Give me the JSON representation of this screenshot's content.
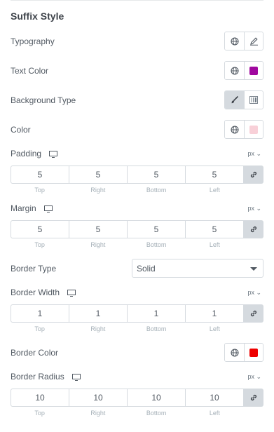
{
  "section": {
    "title": "Suffix Style"
  },
  "typography": {
    "label": "Typography"
  },
  "text_color": {
    "label": "Text Color",
    "swatch": "#a0089f"
  },
  "background_type": {
    "label": "Background Type"
  },
  "color": {
    "label": "Color",
    "swatch": "#f8d0d8"
  },
  "padding": {
    "label": "Padding",
    "unit": "px",
    "values": [
      "5",
      "5",
      "5",
      "5"
    ],
    "sub": [
      "Top",
      "Right",
      "Bottom",
      "Left"
    ]
  },
  "margin": {
    "label": "Margin",
    "unit": "px",
    "values": [
      "5",
      "5",
      "5",
      "5"
    ],
    "sub": [
      "Top",
      "Right",
      "Bottom",
      "Left"
    ]
  },
  "border_type": {
    "label": "Border Type",
    "selected": "Solid"
  },
  "border_width": {
    "label": "Border Width",
    "unit": "px",
    "values": [
      "1",
      "1",
      "1",
      "1"
    ],
    "sub": [
      "Top",
      "Right",
      "Bottom",
      "Left"
    ]
  },
  "border_color": {
    "label": "Border Color",
    "swatch": "#ee0000"
  },
  "border_radius": {
    "label": "Border Radius",
    "unit": "px",
    "values": [
      "10",
      "10",
      "10",
      "10"
    ],
    "sub": [
      "Top",
      "Right",
      "Bottom",
      "Left"
    ]
  }
}
